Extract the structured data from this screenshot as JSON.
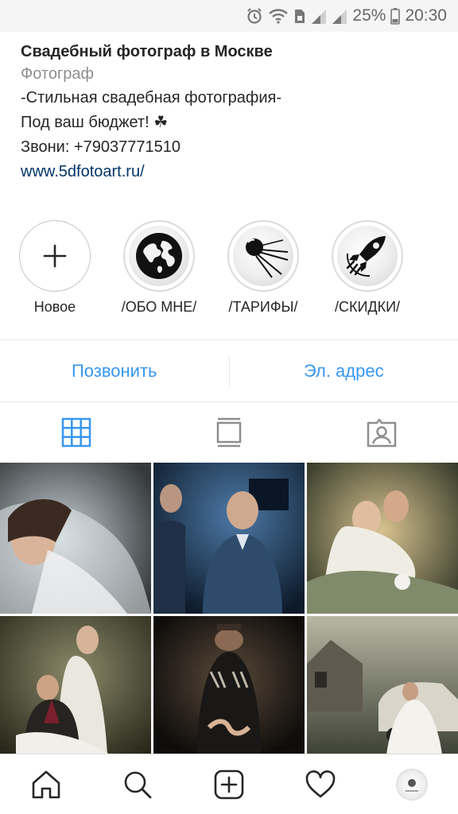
{
  "status_bar": {
    "battery": "25%",
    "time": "20:30",
    "icons": [
      "alarm-icon",
      "wifi-icon",
      "sim-icon",
      "signal-icon",
      "signal-icon",
      "battery-icon"
    ]
  },
  "profile": {
    "name": "Свадебный фотограф в Москве",
    "category": "Фотограф",
    "bio_lines": [
      "-Стильная свадебная фотография-",
      "Под ваш бюджет! ☘",
      "Звони: +79037771510"
    ],
    "website": "www.5dfotoart.ru/"
  },
  "highlights": [
    {
      "label": "Новое",
      "icon": "plus-icon"
    },
    {
      "label": "/ОБО МНЕ/",
      "icon": "globe-icon"
    },
    {
      "label": "/ТАРИФЫ/",
      "icon": "satellite-icon"
    },
    {
      "label": "/СКИДКИ/",
      "icon": "rocket-icon"
    }
  ],
  "actions": {
    "call": "Позвонить",
    "email": "Эл. адрес"
  },
  "tabs": [
    {
      "name": "grid",
      "icon": "grid-icon",
      "active": true
    },
    {
      "name": "feed",
      "icon": "feed-icon",
      "active": false
    },
    {
      "name": "tagged",
      "icon": "tagged-icon",
      "active": false
    }
  ],
  "accent_color": "#3897f0",
  "posts": [
    {
      "icon": "photo-bride-veil"
    },
    {
      "icon": "photo-groom-blue"
    },
    {
      "icon": "photo-couple-embrace"
    },
    {
      "icon": "photo-couple-room"
    },
    {
      "icon": "photo-couple-dark"
    },
    {
      "icon": "photo-couple-car"
    }
  ],
  "bottom_nav": [
    "home-icon",
    "search-icon",
    "new-post-icon",
    "activity-icon",
    "profile-avatar"
  ]
}
